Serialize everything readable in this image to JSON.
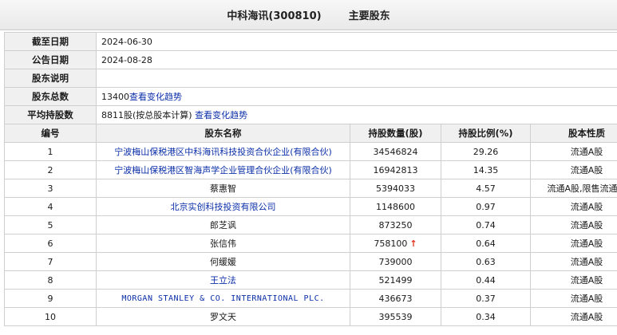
{
  "header": {
    "title": "中科海讯(300810)",
    "subtitle": "主要股东"
  },
  "info": {
    "as_of_label": "截至日期",
    "as_of_value": "2024-06-30",
    "announce_label": "公告日期",
    "announce_value": "2024-08-28",
    "desc_label": "股东说明",
    "desc_value": "",
    "total_label": "股东总数",
    "total_value": "13400",
    "total_link": "查看变化趋势",
    "avg_label": "平均持股数",
    "avg_value": "8811股(按总股本计算)",
    "avg_link": "查看变化趋势"
  },
  "columns": [
    "编号",
    "股东名称",
    "持股数量(股)",
    "持股比例(%)",
    "股本性质"
  ],
  "rows": [
    {
      "no": "1",
      "name": "宁波梅山保税港区中科海讯科技投资合伙企业(有限合伙)",
      "shares": "34546824",
      "ratio": "29.26",
      "type": "流通A股",
      "is_link": true,
      "arrow": ""
    },
    {
      "no": "2",
      "name": "宁波梅山保税港区智海声学企业管理合伙企业(有限合伙)",
      "shares": "16942813",
      "ratio": "14.35",
      "type": "流通A股",
      "is_link": true,
      "arrow": ""
    },
    {
      "no": "3",
      "name": "蔡惠智",
      "shares": "5394033",
      "ratio": "4.57",
      "type": "流通A股,限售流通股",
      "is_link": false,
      "arrow": ""
    },
    {
      "no": "4",
      "name": "北京实创科技投资有限公司",
      "shares": "1148600",
      "ratio": "0.97",
      "type": "流通A股",
      "is_link": true,
      "arrow": ""
    },
    {
      "no": "5",
      "name": "郎芝讽",
      "shares": "873250",
      "ratio": "0.74",
      "type": "流通A股",
      "is_link": false,
      "arrow": ""
    },
    {
      "no": "6",
      "name": "张信伟",
      "shares": "758100",
      "ratio": "0.64",
      "type": "流通A股",
      "is_link": false,
      "arrow": "↑"
    },
    {
      "no": "7",
      "name": "何缓媛",
      "shares": "739000",
      "ratio": "0.63",
      "type": "流通A股",
      "is_link": false,
      "arrow": ""
    },
    {
      "no": "8",
      "name": "王立法",
      "shares": "521499",
      "ratio": "0.44",
      "type": "流通A股",
      "is_link": true,
      "arrow": ""
    },
    {
      "no": "9",
      "name": "MORGAN STANLEY & CO. INTERNATIONAL PLC.",
      "shares": "436673",
      "ratio": "0.37",
      "type": "流通A股",
      "is_link": true,
      "arrow": "",
      "mono": true
    },
    {
      "no": "10",
      "name": "罗文天",
      "shares": "395539",
      "ratio": "0.34",
      "type": "流通A股",
      "is_link": false,
      "arrow": ""
    }
  ],
  "colors": {
    "link": "#0b2fa8",
    "arrow_up": "#e0301e",
    "label_bg": "#f0f0f0"
  }
}
